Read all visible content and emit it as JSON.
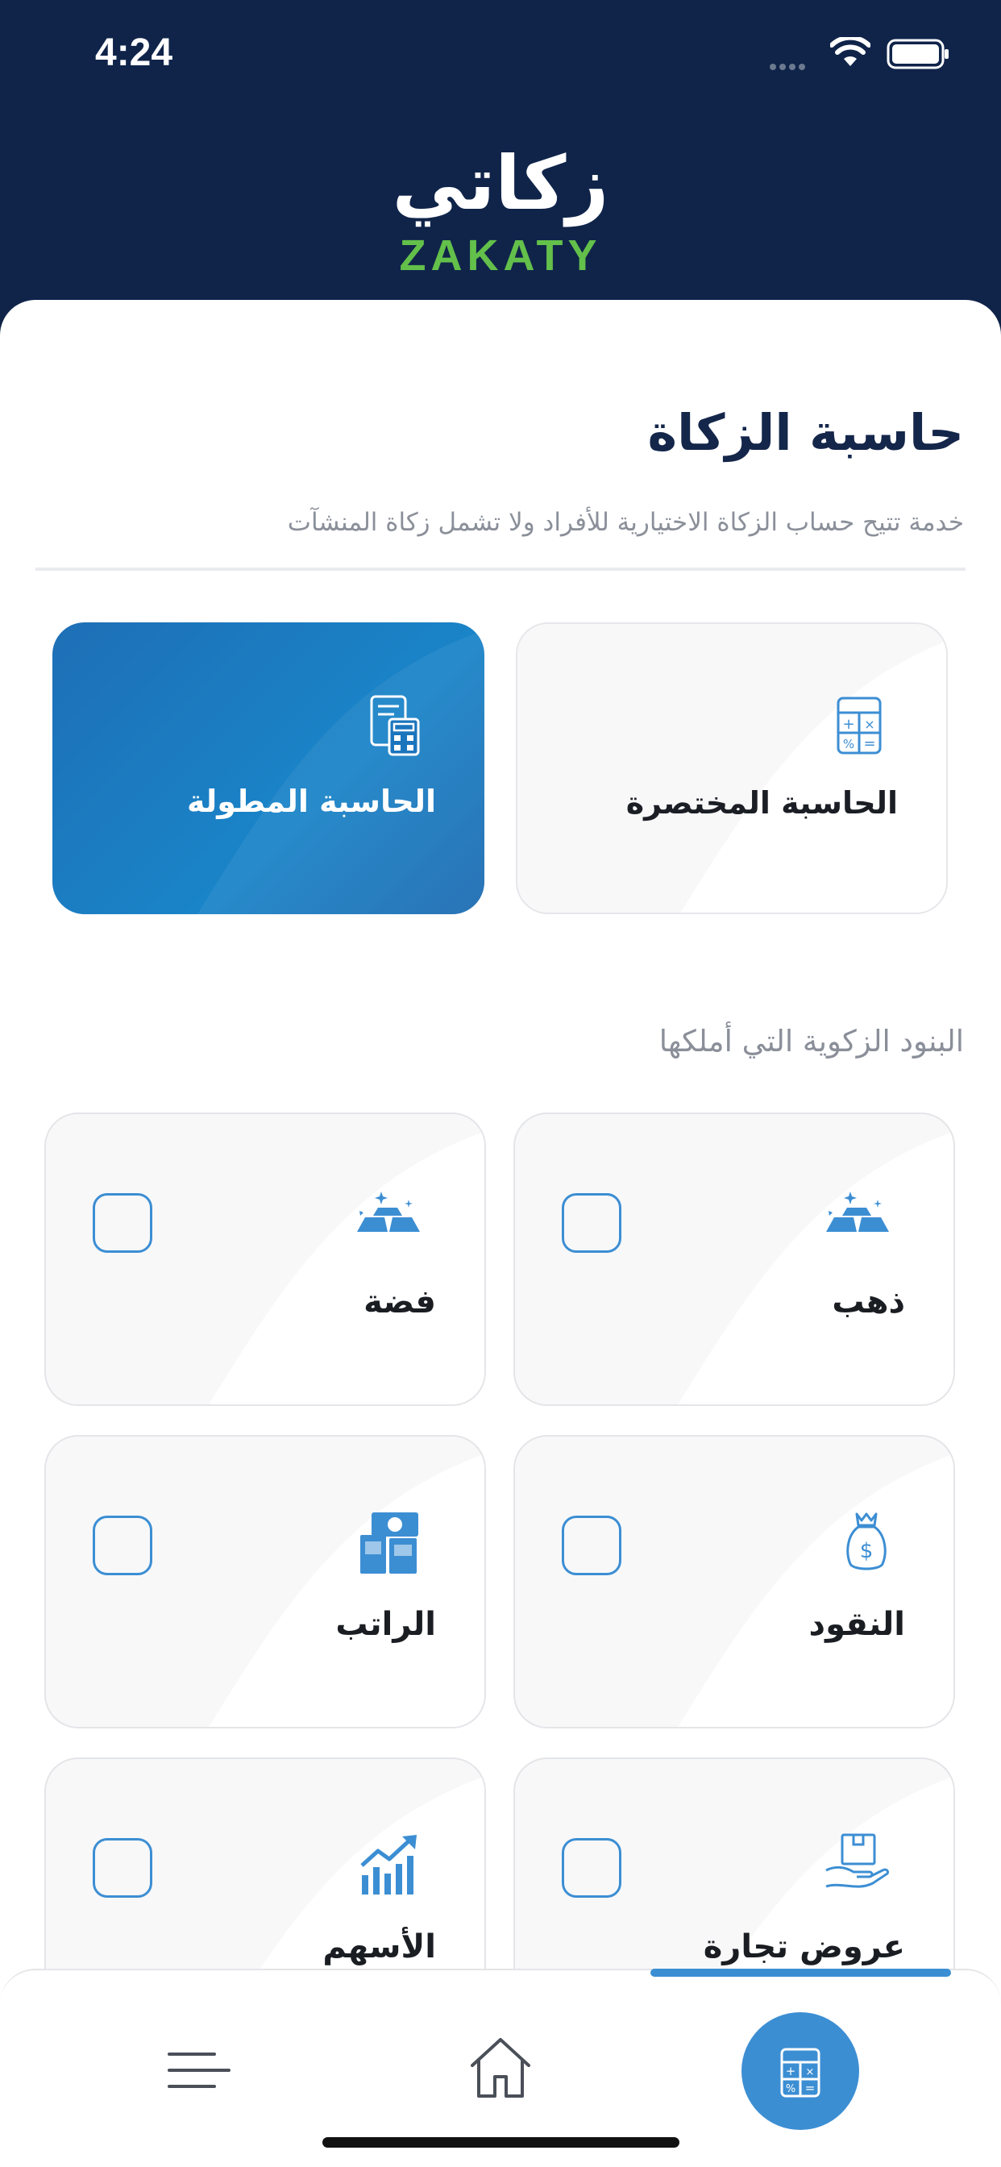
{
  "status": {
    "time": "4:24"
  },
  "header": {
    "logo_ar": "زكاتي",
    "logo_en": "ZAKATY"
  },
  "main": {
    "title": "حاسبة الزكاة",
    "subtitle": "خدمة تتيح حساب الزكاة الاختيارية للأفراد ولا تشمل زكاة المنشآت",
    "calculators": [
      {
        "label": "الحاسبة المختصرة",
        "icon": "calculator-icon"
      },
      {
        "label": "الحاسبة المطولة",
        "icon": "calculator-sheet-icon"
      }
    ],
    "section_label": "البنود الزكوية التي أملكها",
    "items": [
      {
        "label": "ذهب",
        "icon": "gold-bars-icon"
      },
      {
        "label": "فضة",
        "icon": "silver-bars-icon"
      },
      {
        "label": "النقود",
        "icon": "money-bag-icon"
      },
      {
        "label": "الراتب",
        "icon": "salary-icon"
      },
      {
        "label": "عروض تجارة",
        "icon": "trade-goods-icon"
      },
      {
        "label": "الأسهم",
        "icon": "stocks-chart-icon"
      }
    ]
  },
  "nav": {
    "items": [
      "menu-icon",
      "home-icon",
      "calculator-icon"
    ],
    "active": "calculator-icon"
  },
  "colors": {
    "navy": "#10244a",
    "green": "#63c04a",
    "accent": "#3c8ed3"
  }
}
